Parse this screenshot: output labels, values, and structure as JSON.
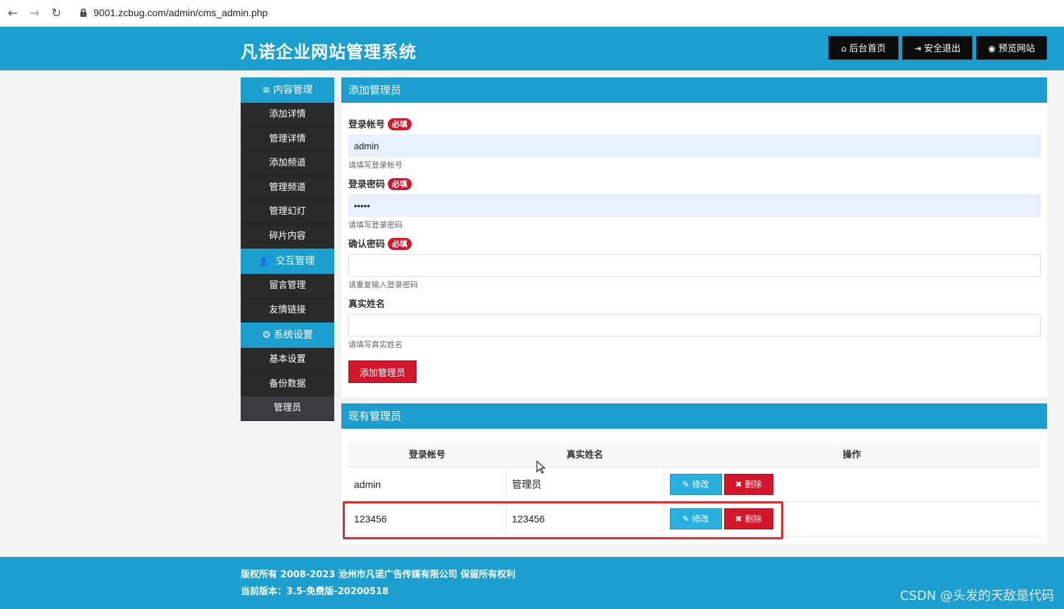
{
  "browser": {
    "back_icon": "←",
    "forward_icon": "→",
    "reload_icon": "↻",
    "url": "9001.zcbug.com/admin/cms_admin.php"
  },
  "header": {
    "title": "凡诺企业网站管理系统",
    "buttons": [
      {
        "icon": "⌂",
        "label": "后台首页"
      },
      {
        "icon": "⇥",
        "label": "安全退出"
      },
      {
        "icon": "◉",
        "label": "预览网站"
      }
    ]
  },
  "sidebar": {
    "sections": [
      {
        "icon": "≡",
        "label": "内容管理",
        "items": [
          "添加详情",
          "管理详情",
          "添加频道",
          "管理频道",
          "管理幻灯",
          "碎片内容"
        ]
      },
      {
        "icon": "👥",
        "label": "交互管理",
        "items": [
          "留言管理",
          "友情链接"
        ]
      },
      {
        "icon": "⚙",
        "label": "系统设置",
        "items": [
          "基本设置",
          "备份数据",
          "管理员"
        ]
      }
    ]
  },
  "add_panel": {
    "title": "添加管理员",
    "required_badge": "必填",
    "fields": [
      {
        "label": "登录帐号",
        "value": "admin",
        "help": "请填写登录帐号"
      },
      {
        "label": "登录密码",
        "value": "•••••",
        "help": "请填写登录密码"
      },
      {
        "label": "确认密码",
        "value": "",
        "help": "请重复输入登录密码"
      },
      {
        "label": "真实姓名",
        "value": "",
        "help": "请填写真实姓名"
      }
    ],
    "submit_label": "添加管理员"
  },
  "list_panel": {
    "title": "现有管理员",
    "columns": [
      "登录帐号",
      "真实姓名",
      "操作"
    ],
    "rows": [
      {
        "account": "admin",
        "name": "管理员"
      },
      {
        "account": "123456",
        "name": "123456"
      }
    ],
    "edit_label": "修改",
    "edit_icon": "✎",
    "delete_label": "删除",
    "delete_icon": "✖"
  },
  "footer": {
    "copyright": "版权所有 2008-2023 沧州市凡诺广告传媒有限公司 保留所有权利",
    "version": "当前版本：3.5-免费版-20200518",
    "watermark": "CSDN @头发的天敌是代码"
  },
  "colors": {
    "accent": "#1a9fcf",
    "danger": "#d3162c",
    "sidebar_bg": "#2a2a2a"
  }
}
